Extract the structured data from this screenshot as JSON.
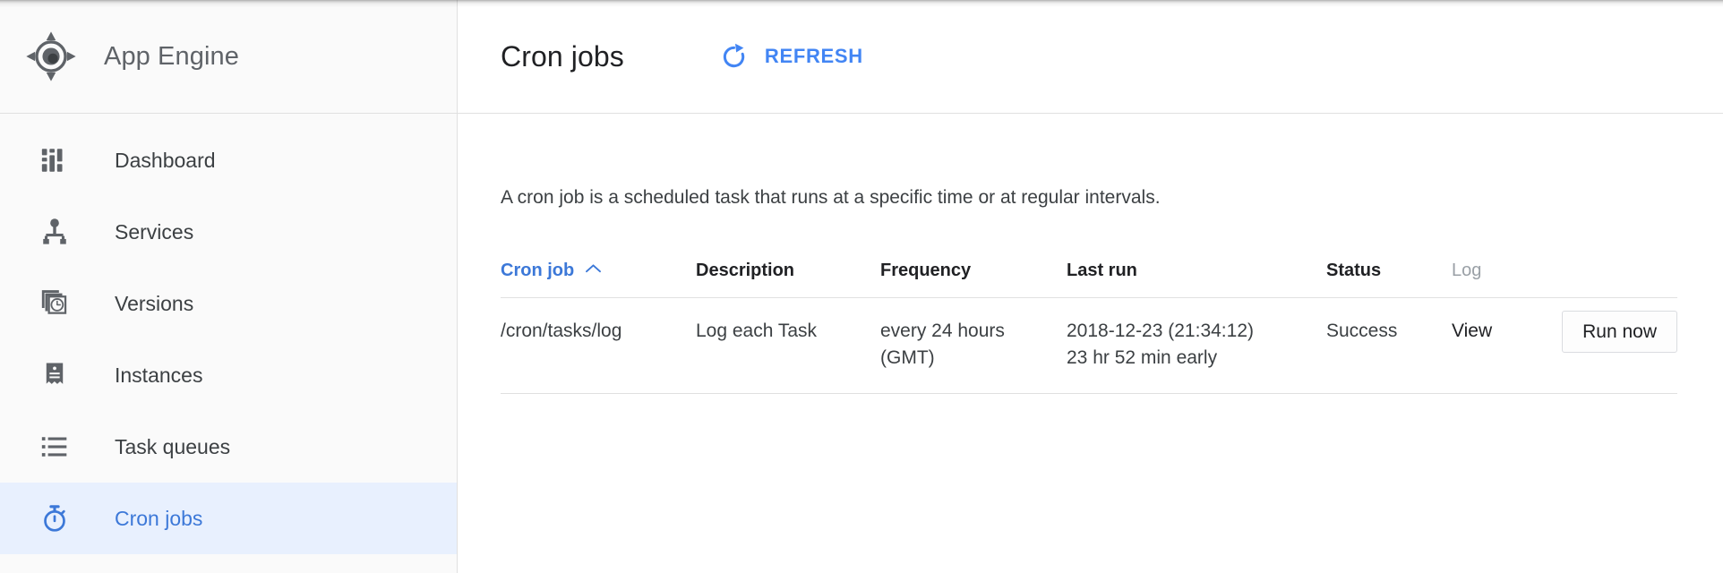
{
  "brand": {
    "logo_icon": "app-engine-logo-icon",
    "title": "App Engine"
  },
  "sidebar": {
    "items": [
      {
        "label": "Dashboard",
        "icon": "dashboard-icon",
        "selected": false
      },
      {
        "label": "Services",
        "icon": "services-icon",
        "selected": false
      },
      {
        "label": "Versions",
        "icon": "versions-icon",
        "selected": false
      },
      {
        "label": "Instances",
        "icon": "instances-icon",
        "selected": false
      },
      {
        "label": "Task queues",
        "icon": "task-queues-icon",
        "selected": false
      },
      {
        "label": "Cron jobs",
        "icon": "stopwatch-icon",
        "selected": true
      }
    ]
  },
  "header": {
    "title": "Cron jobs",
    "refresh_label": "REFRESH",
    "refresh_icon": "refresh-icon"
  },
  "main": {
    "intro": "A cron job is a scheduled task that runs at a specific time or at regular intervals.",
    "table": {
      "columns": [
        {
          "label": "Cron job",
          "sorted": true,
          "sort_direction": "asc",
          "muted": false
        },
        {
          "label": "Description",
          "sorted": false,
          "sort_direction": "",
          "muted": false
        },
        {
          "label": "Frequency",
          "sorted": false,
          "sort_direction": "",
          "muted": false
        },
        {
          "label": "Last run",
          "sorted": false,
          "sort_direction": "",
          "muted": false
        },
        {
          "label": "Status",
          "sorted": false,
          "sort_direction": "",
          "muted": false
        },
        {
          "label": "Log",
          "sorted": false,
          "sort_direction": "",
          "muted": true
        },
        {
          "label": "",
          "sorted": false,
          "sort_direction": "",
          "muted": false
        }
      ],
      "rows": [
        {
          "cron_job": "/cron/tasks/log",
          "description": "Log each Task",
          "frequency_line1": "every 24 hours",
          "frequency_line2": "(GMT)",
          "last_run_line1": "2018-12-23 (21:34:12)",
          "last_run_line2": "23 hr 52 min early",
          "status": "Success",
          "log_link": "View",
          "action_label": "Run now"
        }
      ]
    }
  },
  "colors": {
    "accent_blue": "#4285f4",
    "link_blue": "#3c78d8",
    "selected_bg": "#e8f0fe",
    "sidebar_bg": "#fafafa",
    "divider": "#e0e0e0",
    "text_primary": "#202124",
    "text_secondary": "#5f6368",
    "text_muted": "#9aa0a6"
  }
}
